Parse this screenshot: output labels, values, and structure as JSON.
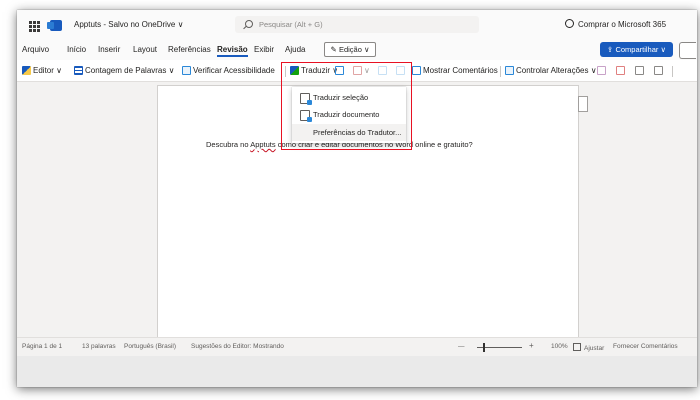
{
  "titlebar": {
    "doc_title": "Apptuts - Salvo no OneDrive ∨",
    "search_placeholder": "Pesquisar (Alt + G)",
    "buy_label": "Comprar o Microsoft 365"
  },
  "menu": {
    "items": [
      "Arquivo",
      "Início",
      "Inserir",
      "Layout",
      "Referências",
      "Revisão",
      "Exibir",
      "Ajuda"
    ],
    "active": "Revisão",
    "edit_mode": "Edição ∨",
    "share_label": "Compartilhar ∨"
  },
  "ribbon": {
    "editor": "Editor ∨",
    "word_count": "Contagem de Palavras ∨",
    "accessibility": "Verificar Acessibilidade",
    "translate": "Traduzir ∨",
    "show_comments": "Mostrar Comentários",
    "track_changes": "Controlar Alterações ∨"
  },
  "dropdown": {
    "items": [
      "Traduzir seleção",
      "Traduzir documento",
      "Preferências do Tradutor..."
    ]
  },
  "document": {
    "text_before": "Descubra no ",
    "text_squiggle": "Apptuts",
    "text_after": " como criar e editar documentos no Word online e gratuito?"
  },
  "status": {
    "page": "Página 1 de 1",
    "words": "13 palavras",
    "language": "Português (Brasil)",
    "editor_suggestions": "Sugestões do Editor: Mostrando",
    "zoom_minus": "—",
    "zoom_plus": "+",
    "zoom_level": "100%",
    "fit": "Ajustar",
    "feedback": "Fornecer Comentários"
  },
  "colors": {
    "accent": "#185abd",
    "highlight": "#e81123"
  }
}
